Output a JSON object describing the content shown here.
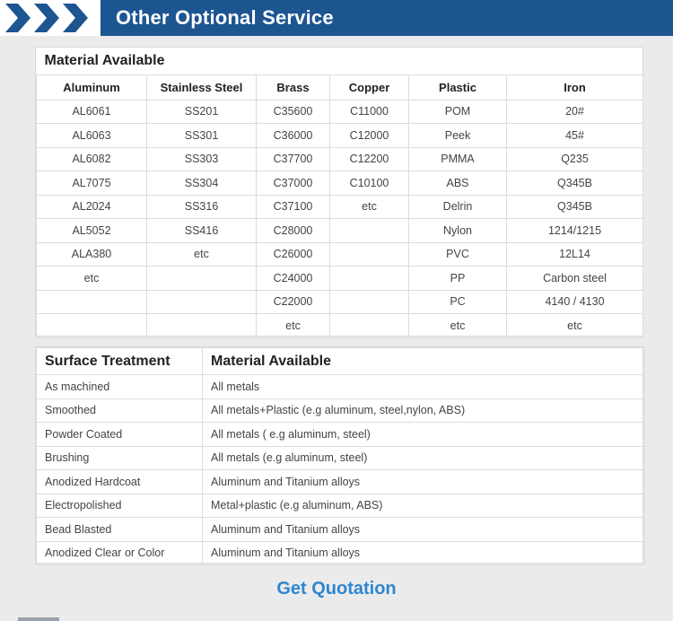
{
  "banner": {
    "title": "Other Optional Service",
    "colors": {
      "bar": "#1d5591",
      "chevron": "#1d5591"
    }
  },
  "materials": {
    "heading": "Material Available",
    "columns": [
      "Aluminum",
      "Stainless Steel",
      "Brass",
      "Copper",
      "Plastic",
      "Iron"
    ],
    "rows": [
      [
        "AL6061",
        "SS201",
        "C35600",
        "C11000",
        "POM",
        "20#"
      ],
      [
        "AL6063",
        "SS301",
        "C36000",
        "C12000",
        "Peek",
        "45#"
      ],
      [
        "AL6082",
        "SS303",
        "C37700",
        "C12200",
        "PMMA",
        "Q235"
      ],
      [
        "AL7075",
        "SS304",
        "C37000",
        "C10100",
        "ABS",
        "Q345B"
      ],
      [
        "AL2024",
        "SS316",
        "C37100",
        "etc",
        "Delrin",
        "Q345B"
      ],
      [
        "AL5052",
        "SS416",
        "C28000",
        "",
        "Nylon",
        "1214/1215"
      ],
      [
        "ALA380",
        "etc",
        "C26000",
        "",
        "PVC",
        "12L14"
      ],
      [
        "etc",
        "",
        "C24000",
        "",
        "PP",
        "Carbon steel"
      ],
      [
        "",
        "",
        "C22000",
        "",
        "PC",
        "4140 / 4130"
      ],
      [
        "",
        "",
        "etc",
        "",
        "etc",
        "etc"
      ]
    ]
  },
  "surface": {
    "headers": [
      "Surface Treatment",
      "Material Available"
    ],
    "rows": [
      [
        "As machined",
        "All metals"
      ],
      [
        "Smoothed",
        "All metals+Plastic (e.g aluminum, steel,nylon, ABS)"
      ],
      [
        "Powder Coated",
        "All metals ( e.g aluminum, steel)"
      ],
      [
        "Brushing",
        "All metals (e.g aluminum, steel)"
      ],
      [
        "Anodized Hardcoat",
        "Aluminum and Titanium alloys"
      ],
      [
        "Electropolished",
        "Metal+plastic (e.g aluminum, ABS)"
      ],
      [
        "Bead Blasted",
        "Aluminum and Titanium alloys"
      ],
      [
        "Anodized Clear or Color",
        "Aluminum and Titanium alloys"
      ]
    ]
  },
  "cta": {
    "label": "Get Quotation",
    "color": "#2e86d0"
  }
}
